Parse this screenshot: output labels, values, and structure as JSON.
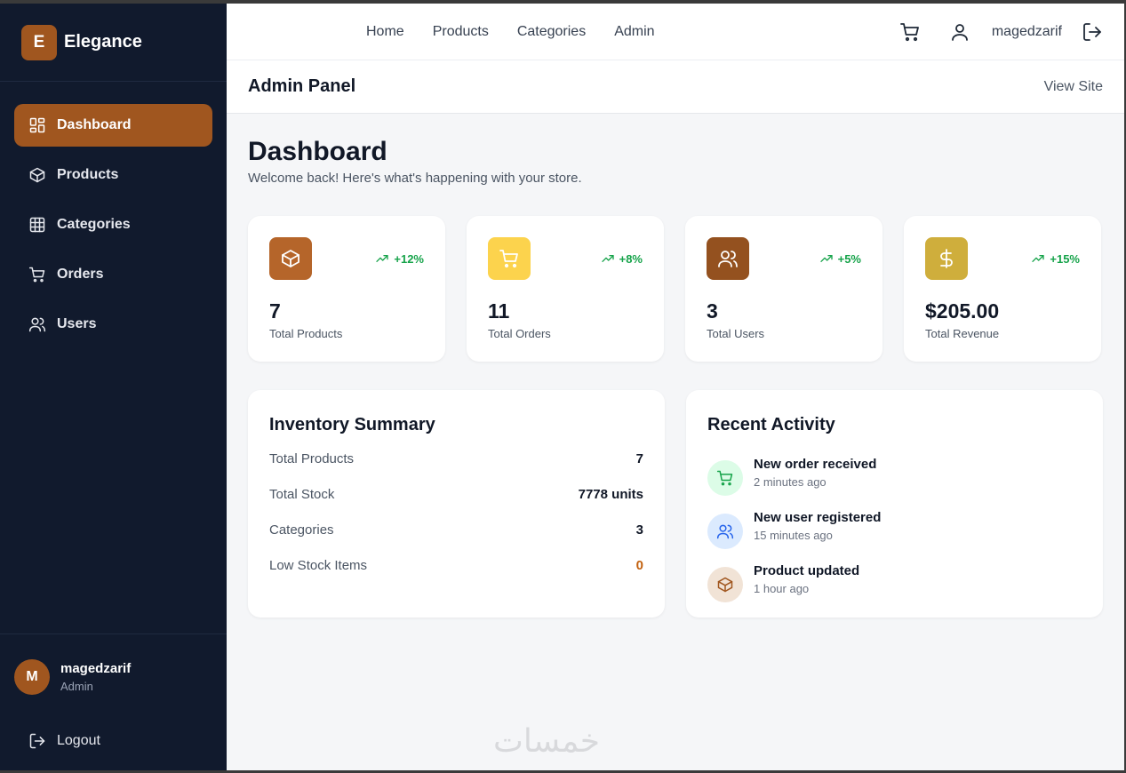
{
  "brand": {
    "logo_letter": "E",
    "name": "Elegance",
    "accent": "#a0561f"
  },
  "sidebar": {
    "items": [
      {
        "label": "Dashboard",
        "icon": "dashboard-icon",
        "active": true
      },
      {
        "label": "Products",
        "icon": "box-icon",
        "active": false
      },
      {
        "label": "Categories",
        "icon": "grid-icon",
        "active": false
      },
      {
        "label": "Orders",
        "icon": "cart-icon",
        "active": false
      },
      {
        "label": "Users",
        "icon": "users-icon",
        "active": false
      }
    ],
    "user": {
      "initial": "M",
      "name": "magedzarif",
      "role": "Admin"
    },
    "logout_label": "Logout"
  },
  "topbar": {
    "links": [
      "Home",
      "Products",
      "Categories",
      "Admin"
    ],
    "username": "magedzarif"
  },
  "adminbar": {
    "title": "Admin Panel",
    "view_site": "View Site"
  },
  "page": {
    "title": "Dashboard",
    "subtitle": "Welcome back! Here's what's happening with your store."
  },
  "stats": [
    {
      "value": "7",
      "label": "Total Products",
      "trend": "+12%",
      "icon": "box-icon",
      "color": "#b5652a"
    },
    {
      "value": "11",
      "label": "Total Orders",
      "trend": "+8%",
      "icon": "cart-icon",
      "color": "#fcd34d"
    },
    {
      "value": "3",
      "label": "Total Users",
      "trend": "+5%",
      "icon": "users-icon",
      "color": "#94511f"
    },
    {
      "value": "$205.00",
      "label": "Total Revenue",
      "trend": "+15%",
      "icon": "dollar-icon",
      "color": "#cfae3c"
    }
  ],
  "inventory": {
    "title": "Inventory Summary",
    "rows": [
      {
        "label": "Total Products",
        "value": "7"
      },
      {
        "label": "Total Stock",
        "value": "7778 units"
      },
      {
        "label": "Categories",
        "value": "3"
      },
      {
        "label": "Low Stock Items",
        "value": "0"
      }
    ]
  },
  "activity": {
    "title": "Recent Activity",
    "items": [
      {
        "title": "New order received",
        "time": "2 minutes ago",
        "icon": "cart-icon",
        "bg": "#dcfce7",
        "fg": "#16a34a"
      },
      {
        "title": "New user registered",
        "time": "15 minutes ago",
        "icon": "users-icon",
        "bg": "#dbeafe",
        "fg": "#2563eb"
      },
      {
        "title": "Product updated",
        "time": "1 hour ago",
        "icon": "box-icon",
        "bg": "#f1e3d6",
        "fg": "#a0561f"
      }
    ]
  },
  "watermark": "خمسات"
}
